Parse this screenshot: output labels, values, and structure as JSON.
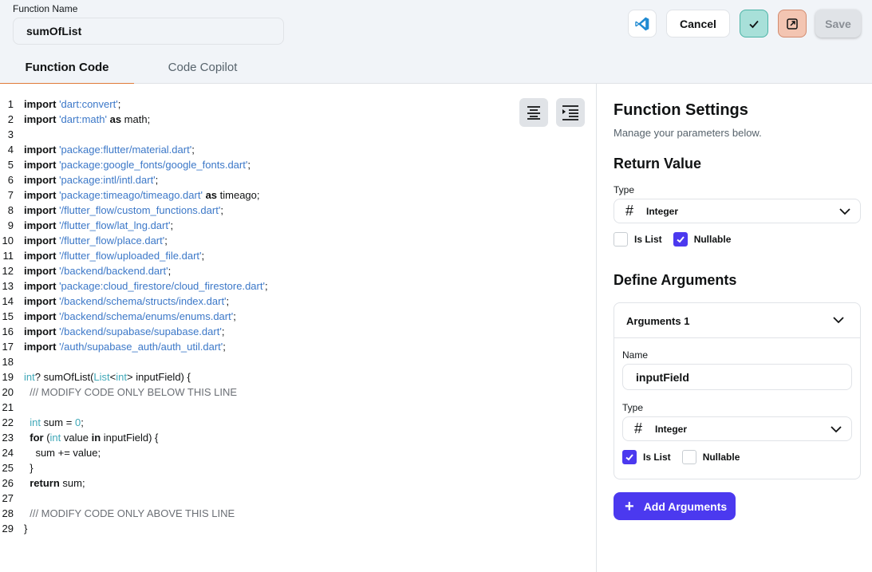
{
  "header": {
    "function_name_label": "Function Name",
    "function_name_value": "sumOfList",
    "cancel_label": "Cancel",
    "save_label": "Save",
    "colors": {
      "accent": "#4b39ef",
      "check_bg": "#a8e0d9",
      "open_bg": "#f3c5b2",
      "tab_underline": "#e07b39"
    }
  },
  "tabs": [
    {
      "label": "Function Code",
      "active": true
    },
    {
      "label": "Code Copilot",
      "active": false
    }
  ],
  "code_lines": [
    [
      {
        "t": "kw",
        "v": "import"
      },
      {
        "t": "plain",
        "v": " "
      },
      {
        "t": "str",
        "v": "'dart:convert'"
      },
      {
        "t": "plain",
        "v": ";"
      }
    ],
    [
      {
        "t": "kw",
        "v": "import"
      },
      {
        "t": "plain",
        "v": " "
      },
      {
        "t": "str",
        "v": "'dart:math'"
      },
      {
        "t": "plain",
        "v": " "
      },
      {
        "t": "kw",
        "v": "as"
      },
      {
        "t": "plain",
        "v": " math;"
      }
    ],
    [],
    [
      {
        "t": "kw",
        "v": "import"
      },
      {
        "t": "plain",
        "v": " "
      },
      {
        "t": "str",
        "v": "'package:flutter/material.dart'"
      },
      {
        "t": "plain",
        "v": ";"
      }
    ],
    [
      {
        "t": "kw",
        "v": "import"
      },
      {
        "t": "plain",
        "v": " "
      },
      {
        "t": "str",
        "v": "'package:google_fonts/google_fonts.dart'"
      },
      {
        "t": "plain",
        "v": ";"
      }
    ],
    [
      {
        "t": "kw",
        "v": "import"
      },
      {
        "t": "plain",
        "v": " "
      },
      {
        "t": "str",
        "v": "'package:intl/intl.dart'"
      },
      {
        "t": "plain",
        "v": ";"
      }
    ],
    [
      {
        "t": "kw",
        "v": "import"
      },
      {
        "t": "plain",
        "v": " "
      },
      {
        "t": "str",
        "v": "'package:timeago/timeago.dart'"
      },
      {
        "t": "plain",
        "v": " "
      },
      {
        "t": "kw",
        "v": "as"
      },
      {
        "t": "plain",
        "v": " timeago;"
      }
    ],
    [
      {
        "t": "kw",
        "v": "import"
      },
      {
        "t": "plain",
        "v": " "
      },
      {
        "t": "str",
        "v": "'/flutter_flow/custom_functions.dart'"
      },
      {
        "t": "plain",
        "v": ";"
      }
    ],
    [
      {
        "t": "kw",
        "v": "import"
      },
      {
        "t": "plain",
        "v": " "
      },
      {
        "t": "str",
        "v": "'/flutter_flow/lat_lng.dart'"
      },
      {
        "t": "plain",
        "v": ";"
      }
    ],
    [
      {
        "t": "kw",
        "v": "import"
      },
      {
        "t": "plain",
        "v": " "
      },
      {
        "t": "str",
        "v": "'/flutter_flow/place.dart'"
      },
      {
        "t": "plain",
        "v": ";"
      }
    ],
    [
      {
        "t": "kw",
        "v": "import"
      },
      {
        "t": "plain",
        "v": " "
      },
      {
        "t": "str",
        "v": "'/flutter_flow/uploaded_file.dart'"
      },
      {
        "t": "plain",
        "v": ";"
      }
    ],
    [
      {
        "t": "kw",
        "v": "import"
      },
      {
        "t": "plain",
        "v": " "
      },
      {
        "t": "str",
        "v": "'/backend/backend.dart'"
      },
      {
        "t": "plain",
        "v": ";"
      }
    ],
    [
      {
        "t": "kw",
        "v": "import"
      },
      {
        "t": "plain",
        "v": " "
      },
      {
        "t": "str",
        "v": "'package:cloud_firestore/cloud_firestore.dart'"
      },
      {
        "t": "plain",
        "v": ";"
      }
    ],
    [
      {
        "t": "kw",
        "v": "import"
      },
      {
        "t": "plain",
        "v": " "
      },
      {
        "t": "str",
        "v": "'/backend/schema/structs/index.dart'"
      },
      {
        "t": "plain",
        "v": ";"
      }
    ],
    [
      {
        "t": "kw",
        "v": "import"
      },
      {
        "t": "plain",
        "v": " "
      },
      {
        "t": "str",
        "v": "'/backend/schema/enums/enums.dart'"
      },
      {
        "t": "plain",
        "v": ";"
      }
    ],
    [
      {
        "t": "kw",
        "v": "import"
      },
      {
        "t": "plain",
        "v": " "
      },
      {
        "t": "str",
        "v": "'/backend/supabase/supabase.dart'"
      },
      {
        "t": "plain",
        "v": ";"
      }
    ],
    [
      {
        "t": "kw",
        "v": "import"
      },
      {
        "t": "plain",
        "v": " "
      },
      {
        "t": "str",
        "v": "'/auth/supabase_auth/auth_util.dart'"
      },
      {
        "t": "plain",
        "v": ";"
      }
    ],
    [],
    [
      {
        "t": "type",
        "v": "int"
      },
      {
        "t": "plain",
        "v": "? sumOfList("
      },
      {
        "t": "type",
        "v": "List"
      },
      {
        "t": "plain",
        "v": "<"
      },
      {
        "t": "type",
        "v": "int"
      },
      {
        "t": "plain",
        "v": "> inputField) {"
      }
    ],
    [
      {
        "t": "cm",
        "v": "  /// MODIFY CODE ONLY BELOW THIS LINE"
      }
    ],
    [],
    [
      {
        "t": "plain",
        "v": "  "
      },
      {
        "t": "type",
        "v": "int"
      },
      {
        "t": "plain",
        "v": " sum = "
      },
      {
        "t": "num",
        "v": "0"
      },
      {
        "t": "plain",
        "v": ";"
      }
    ],
    [
      {
        "t": "plain",
        "v": "  "
      },
      {
        "t": "kw",
        "v": "for"
      },
      {
        "t": "plain",
        "v": " ("
      },
      {
        "t": "type",
        "v": "int"
      },
      {
        "t": "plain",
        "v": " value "
      },
      {
        "t": "kw",
        "v": "in"
      },
      {
        "t": "plain",
        "v": " inputField) {"
      }
    ],
    [
      {
        "t": "plain",
        "v": "    sum += value;"
      }
    ],
    [
      {
        "t": "plain",
        "v": "  }"
      }
    ],
    [
      {
        "t": "plain",
        "v": "  "
      },
      {
        "t": "kw",
        "v": "return"
      },
      {
        "t": "plain",
        "v": " sum;"
      }
    ],
    [],
    [
      {
        "t": "cm",
        "v": "  /// MODIFY CODE ONLY ABOVE THIS LINE"
      }
    ],
    [
      {
        "t": "plain",
        "v": "}"
      }
    ]
  ],
  "settings": {
    "title": "Function Settings",
    "subtitle": "Manage your parameters below.",
    "return_value": {
      "heading": "Return Value",
      "type_label": "Type",
      "type_value": "Integer",
      "is_list_label": "Is List",
      "is_list": false,
      "nullable_label": "Nullable",
      "nullable": true
    },
    "arguments": {
      "heading": "Define Arguments",
      "card_title": "Arguments 1",
      "name_label": "Name",
      "name_value": "inputField",
      "type_label": "Type",
      "type_value": "Integer",
      "is_list_label": "Is List",
      "is_list": true,
      "nullable_label": "Nullable",
      "nullable": false
    },
    "add_button_label": "Add Arguments"
  }
}
